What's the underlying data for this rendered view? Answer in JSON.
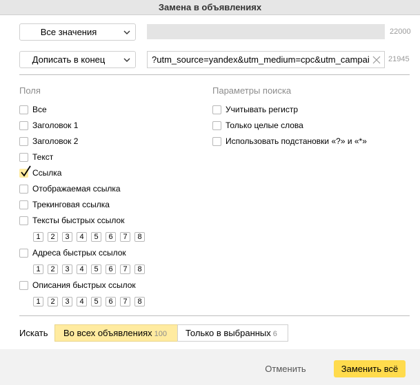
{
  "window": {
    "title": "Замена в объявлениях"
  },
  "top": {
    "scope_select": "Все значения",
    "find_count": "22000",
    "mode_select": "Дописать в конец",
    "replace_value": "?utm_source=yandex&utm_medium=cpc&utm_campaign",
    "replace_count": "21945"
  },
  "fields": {
    "heading": "Поля",
    "items": [
      {
        "label": "Все",
        "checked": false
      },
      {
        "label": "Заголовок 1",
        "checked": false
      },
      {
        "label": "Заголовок 2",
        "checked": false
      },
      {
        "label": "Текст",
        "checked": false
      },
      {
        "label": "Ссылка",
        "checked": true
      },
      {
        "label": "Отображаемая ссылка",
        "checked": false
      },
      {
        "label": "Трекинговая ссылка",
        "checked": false
      },
      {
        "label": "Тексты быстрых ссылок",
        "checked": false
      },
      {
        "label": "Адреса быстрых ссылок",
        "checked": false
      },
      {
        "label": "Описания быстрых ссылок",
        "checked": false
      }
    ],
    "sitelink_numbers": [
      "1",
      "2",
      "3",
      "4",
      "5",
      "6",
      "7",
      "8"
    ]
  },
  "search_params": {
    "heading": "Параметры поиска",
    "items": [
      {
        "label": "Учитывать регистр",
        "checked": false
      },
      {
        "label": "Только целые слова",
        "checked": false
      },
      {
        "label": "Использовать подстановки «?» и «*»",
        "checked": false
      }
    ]
  },
  "scope": {
    "label": "Искать",
    "all_label": "Во всех объявлениях",
    "all_count": "100",
    "selected_label": "Только в выбранных",
    "selected_count": "6"
  },
  "actions": {
    "cancel": "Отменить",
    "replace_all": "Заменить всё"
  },
  "colors": {
    "accent": "#ffdb4d",
    "checked_fill": "#ffeba0"
  }
}
